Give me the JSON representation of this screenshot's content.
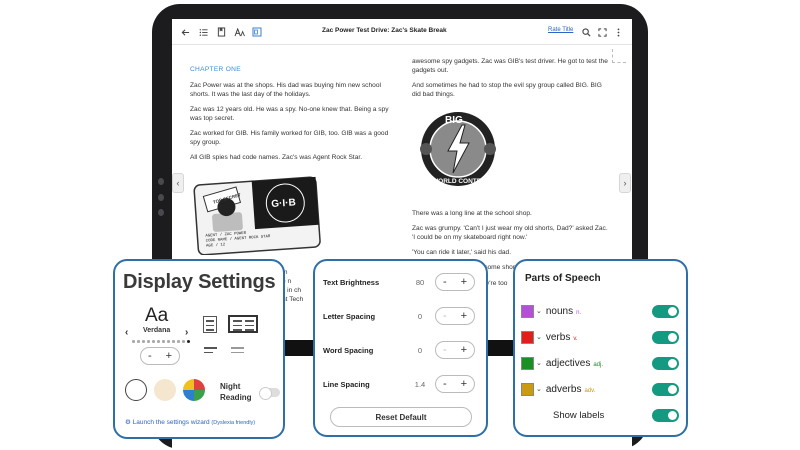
{
  "reader": {
    "book_title": "Zac Power Test Drive: Zac's Skate Break",
    "rate_title": "Rate Title",
    "icons": [
      "back-arrow-icon",
      "contents-list-icon",
      "bookmark-icon",
      "text-size-icon",
      "display-settings-icon",
      "search-icon",
      "fullscreen-icon",
      "more-icon"
    ],
    "chapter": "CHAPTER ONE",
    "left_paragraphs": [
      "Zac Power was at the shops. His dad was buying him new school shorts. It was the last day of the holidays.",
      "Zac was 12 years old. He was a spy. No-one knew that. Being a spy was top secret.",
      "Zac worked for GIB. His family worked for GIB, too. GIB was a good spy group.",
      "All GIB spies had code names. Zac's was Agent Rock Star."
    ],
    "right_paragraphs_top": [
      "awesome spy gadgets. Zac was GIB's test driver. He got to test the gadgets out.",
      "And sometimes he had to stop the evil spy group called BIG. BIG did bad things."
    ],
    "right_paragraphs_bottom": [
      "There was a long line at the school shop.",
      "Zac was grumpy. 'Can't I just wear my old shorts, Dad?' asked Zac. 'I could be on my skateboard right now.'",
      "'You can ride it later,' said his dad.",
      "The shop lady gave Zac some shorts. Zac went to try them"
    ],
    "left_hidden_fragments": [
      "m",
      "e n",
      "s in ch",
      "nt Tech"
    ],
    "right_hidden_fragments": [
      "y're too"
    ],
    "id_card": {
      "stamp": "TOP SECRET",
      "logo": "G·I·B",
      "logo_ring": "GOVERNMENT INVESTIGATION BUREAU",
      "agent_line": "AGENT / ZAC POWER",
      "code_line": "CODE NAME / AGENT ROCK STAR",
      "age_line": "AGE / 12"
    },
    "big_logo": {
      "top": "BIG",
      "bottom": "WORLD CONTROL"
    }
  },
  "display_settings": {
    "title": "Display Settings",
    "font_preview": "Aa",
    "font_name": "Verdana",
    "font_count": 12,
    "font_selected_index": 11,
    "size_minus": "-",
    "size_plus": "+",
    "night_reading": "Night Reading",
    "night_reading_on": false,
    "background_colors": [
      "#ffffff",
      "#f5e6cf"
    ],
    "wizard_link": "Launch the settings wizard",
    "wizard_note": "(Dyslexia friendly)"
  },
  "text_settings": {
    "rows": [
      {
        "label": "Text Brightness",
        "value": "80"
      },
      {
        "label": "Letter Spacing",
        "value": "0"
      },
      {
        "label": "Word Spacing",
        "value": "0"
      },
      {
        "label": "Line Spacing",
        "value": "1.4"
      }
    ],
    "minus": "-",
    "plus": "+",
    "reset_label": "Reset Default"
  },
  "parts_of_speech": {
    "title": "Parts of Speech",
    "items": [
      {
        "word": "nouns",
        "abbr": "n.",
        "color": "#b44fd6",
        "enabled": true
      },
      {
        "word": "verbs",
        "abbr": "v.",
        "color": "#e0201a",
        "enabled": true
      },
      {
        "word": "adjectives",
        "abbr": "adj.",
        "color": "#1a8f22",
        "enabled": true
      },
      {
        "word": "adverbs",
        "abbr": "adv.",
        "color": "#c99a12",
        "enabled": true
      }
    ],
    "show_labels": "Show labels",
    "show_labels_on": true
  },
  "colors": {
    "accent": "#2e6fa8",
    "toggle_on": "#159a82",
    "link": "#2b66c4",
    "chapter": "#3b8bd6"
  }
}
